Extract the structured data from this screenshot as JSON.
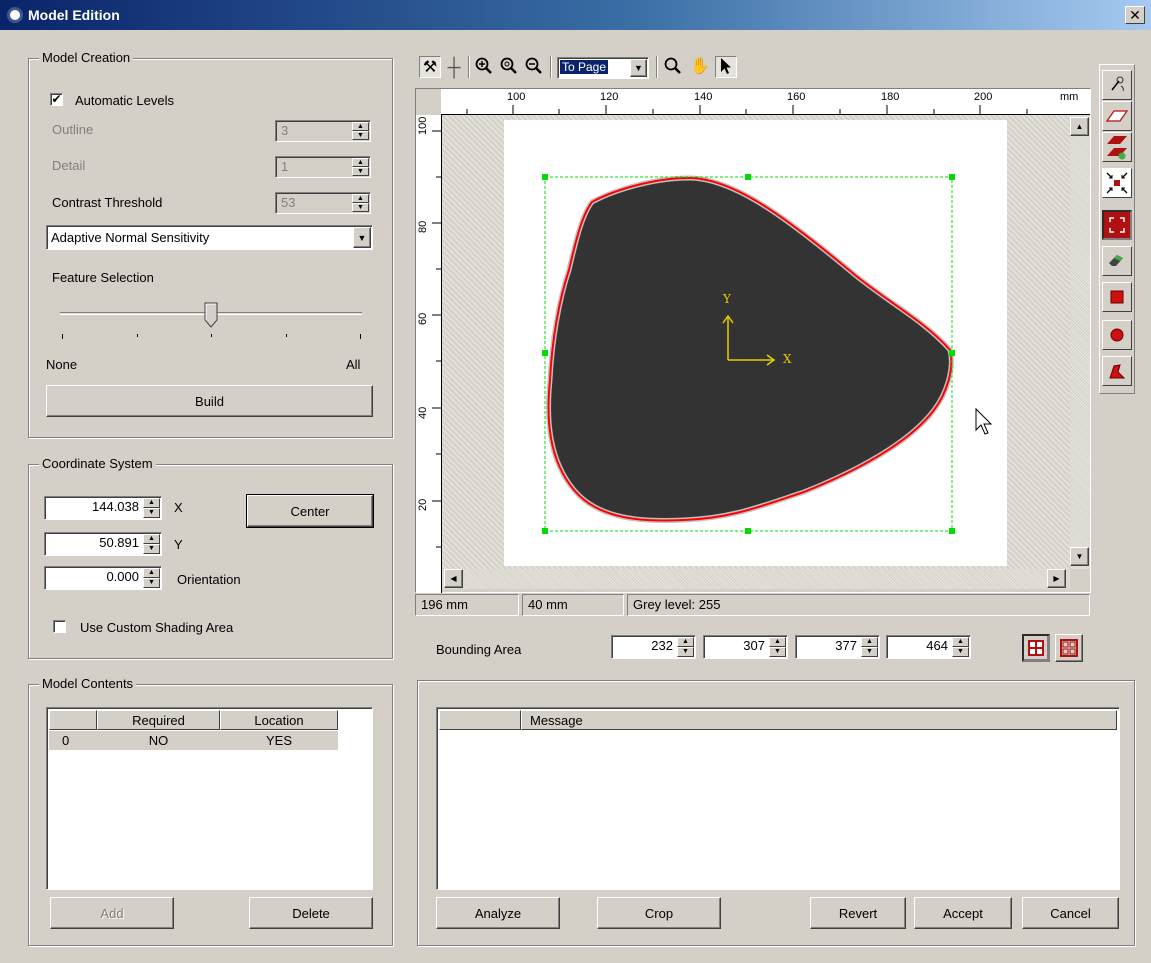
{
  "window": {
    "title": "Model Edition",
    "close_glyph": "✕"
  },
  "model_creation": {
    "legend": "Model Creation",
    "automatic_levels_label": "Automatic Levels",
    "automatic_levels_checked": true,
    "outline_label": "Outline",
    "outline_value": "3",
    "detail_label": "Detail",
    "detail_value": "1",
    "contrast_label": "Contrast Threshold",
    "contrast_value": "53",
    "sensitivity_selected": "Adaptive Normal Sensitivity",
    "feature_selection_label": "Feature Selection",
    "slider_min_label": "None",
    "slider_max_label": "All",
    "slider_level": 0.5,
    "build_label": "Build"
  },
  "coordinate_system": {
    "legend": "Coordinate System",
    "x_value": "144.038",
    "x_label": "X",
    "y_value": "50.891",
    "y_label": "Y",
    "orientation_value": "0.000",
    "orientation_label": "Orientation",
    "center_label": "Center",
    "custom_shading_label": "Use Custom Shading Area",
    "custom_shading_checked": false
  },
  "model_contents": {
    "legend": "Model Contents",
    "columns": [
      "",
      "Required",
      "Location"
    ],
    "rows": [
      {
        "index": "0",
        "required": "NO",
        "location": "YES"
      }
    ],
    "add_label": "Add",
    "delete_label": "Delete"
  },
  "toolbar": {
    "zoom_selected": "To Page",
    "icons": [
      "tools-icon",
      "crosshair-icon",
      "zoom-in-icon",
      "zoom-fit-icon",
      "zoom-out-icon",
      "magnifier-icon",
      "pan-hand-icon",
      "pointer-arrow-icon"
    ]
  },
  "ruler": {
    "unit": "mm",
    "h_labels": [
      "100",
      "120",
      "140",
      "160",
      "180",
      "200"
    ],
    "v_labels": [
      "100",
      "80",
      "60",
      "40",
      "20"
    ]
  },
  "canvas": {
    "axis_x_label": "X",
    "axis_y_label": "Y"
  },
  "status": {
    "x_pos": "196 mm",
    "y_pos": "40 mm",
    "grey_level": "Grey level: 255"
  },
  "bounding_area": {
    "label": "Bounding Area",
    "values": [
      "232",
      "307",
      "377",
      "464"
    ]
  },
  "messages": {
    "column": "Message",
    "analyze_label": "Analyze",
    "crop_label": "Crop",
    "revert_label": "Revert",
    "accept_label": "Accept",
    "cancel_label": "Cancel"
  },
  "colors": {
    "titlebar": "#0a246a",
    "face": "#d4d0c8",
    "outline": "#ff0000",
    "bbox": "#00dd00",
    "axes": "#e6d000",
    "shape": "#333333",
    "tool_accent": "#b01010"
  }
}
